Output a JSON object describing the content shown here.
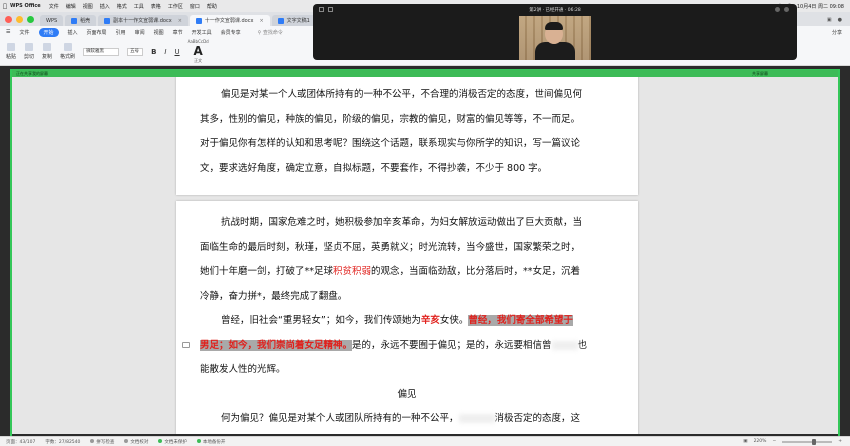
{
  "menubar": {
    "app": "WPS Office",
    "items": [
      "文件",
      "编辑",
      "视图",
      "插入",
      "格式",
      "工具",
      "表格",
      "工作区",
      "窗口",
      "帮助"
    ],
    "clock": "10月4日 周二 09:08"
  },
  "tabs": [
    {
      "label": "WPS"
    },
    {
      "label": "稻壳"
    },
    {
      "label": "副本十一作文宣弱课.docx"
    },
    {
      "label": "十一作文宣弱课.docx"
    },
    {
      "label": "文字文稿1"
    }
  ],
  "ribbon_tabs": [
    "文件",
    "开始",
    "插入",
    "页面布局",
    "引用",
    "审阅",
    "视图",
    "章节",
    "开发工具",
    "会员专享"
  ],
  "ribbon_search": "查找命令",
  "ribbon_share": "分享",
  "ribbon": {
    "cut": "剪切",
    "paste": "粘贴",
    "copy": "复制",
    "format_painter": "格式刷",
    "font": "微软雅黑",
    "size": "五号",
    "style_glyph": "A",
    "style_label": "正文",
    "style_sample": "AaBbCcDd"
  },
  "video": {
    "title": "第2讲 · 已经开通 · 06:28"
  },
  "greenbar": {
    "left": "正在共享我的屏幕",
    "right": "共享屏幕"
  },
  "page1": {
    "lines": [
      "偏见是对某一个人或团体所持有的一种不公平，不合理的消极否定的态度，世间偏见何",
      "其多，性别的偏见，种族的偏见，阶级的偏见，宗教的偏见，财富的偏见等等，不一而足。",
      "对于偏见你有怎样的认知和思考呢？围绕这个话题，联系现实与你所学的知识，写一篇议论",
      "文，要求选好角度，确定立意，自拟标题，不要套作，不得抄袭，不少于 800 字。"
    ]
  },
  "page2": {
    "p1_l1": "抗战时期，国家危难之时，她积极参加辛亥革命，为妇女解放运动做出了巨大贡献，当",
    "p1_l2": "面临生命的最后时刻，秋瑾，坚贞不屈，英勇就义；时光流转，当今盛世，国家繁荣之时，",
    "p1_l3a": "她们十年磨一剑，打破了**足球",
    "p1_l3_red": "积贫积弱",
    "p1_l3b": "的观念，当面临劲敌，比分落后时，**女足，沉着",
    "p1_l4": "冷静，奋力拼*，最终完成了翻盘。",
    "p2_l1a": "曾经，旧社会“重男轻女”；如今，我们传颂她为",
    "p2_l1_red": "辛亥",
    "p2_l1b": "女侠。",
    "p2_l1_hl": "曾经，我们寄全部希望于",
    "p2_l2_hl": "男足；如今，我们崇尚着女足精神。",
    "p2_l2b": "是的，永远不要囿于偏见；是的，永远要相信曾",
    "p2_l2c": "也",
    "p2_l3": "能散发人性的光辉。",
    "heading": "偏见",
    "p3_l1a": "何为偏见？偏见是对某个人或团队所持有的一种不公平，",
    "p3_l1b": "消极否定的态度，这"
  },
  "status": {
    "page": "页面：43/107",
    "words": "字数：27/82540",
    "spell": "拼写检查",
    "proof": "文档校对",
    "protect": "文档未保护",
    "backup": "本地备份开",
    "zoom": "220%"
  }
}
